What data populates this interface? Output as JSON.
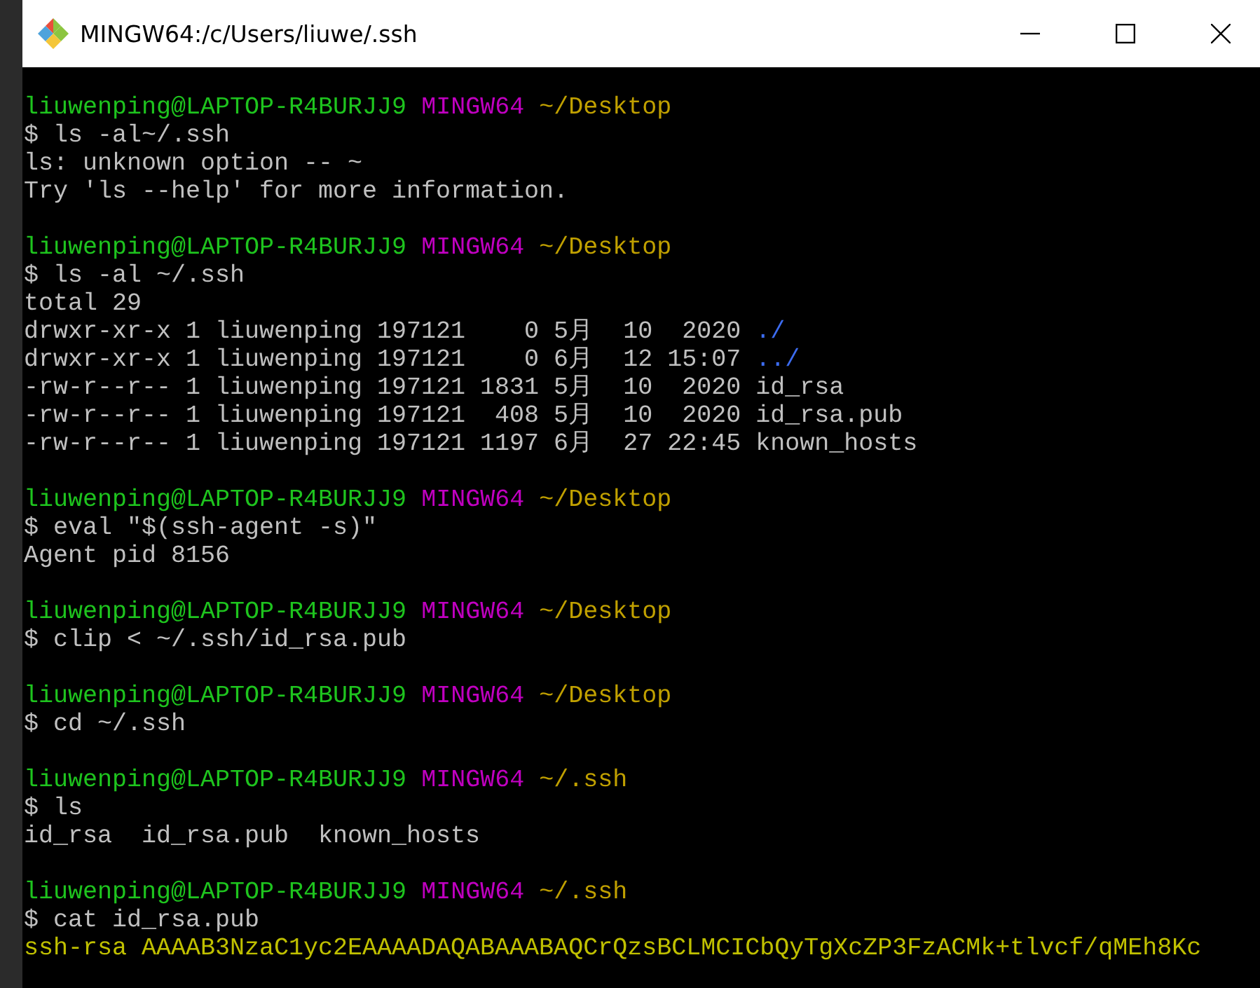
{
  "window": {
    "title": "MINGW64:/c/Users/liuwe/.ssh"
  },
  "lines": [
    {
      "kind": "prompt",
      "user": "liuwenping@LAPTOP-R4BURJJ9",
      "shell": "MINGW64",
      "path": "~/Desktop"
    },
    {
      "kind": "output",
      "segments": [
        {
          "text": "$ ls -al~/.ssh",
          "kind": "plain"
        }
      ]
    },
    {
      "kind": "output",
      "segments": [
        {
          "text": "ls: unknown option -- ~",
          "kind": "plain"
        }
      ]
    },
    {
      "kind": "output",
      "segments": [
        {
          "text": "Try 'ls --help' for more information.",
          "kind": "plain"
        }
      ]
    },
    {
      "kind": "blank"
    },
    {
      "kind": "prompt",
      "user": "liuwenping@LAPTOP-R4BURJJ9",
      "shell": "MINGW64",
      "path": "~/Desktop"
    },
    {
      "kind": "output",
      "segments": [
        {
          "text": "$ ls -al ~/.ssh",
          "kind": "plain"
        }
      ]
    },
    {
      "kind": "output",
      "segments": [
        {
          "text": "total 29",
          "kind": "plain"
        }
      ]
    },
    {
      "kind": "output",
      "segments": [
        {
          "text": "drwxr-xr-x 1 liuwenping 197121    0 5月  10  2020",
          "kind": "plain"
        },
        {
          "text": "./",
          "kind": "directory"
        }
      ]
    },
    {
      "kind": "output",
      "segments": [
        {
          "text": "drwxr-xr-x 1 liuwenping 197121    0 6月  12 15:07",
          "kind": "plain"
        },
        {
          "text": "../",
          "kind": "directory"
        }
      ]
    },
    {
      "kind": "output",
      "segments": [
        {
          "text": "-rw-r--r-- 1 liuwenping 197121 1831 5月  10  2020 id_rsa",
          "kind": "plain"
        }
      ]
    },
    {
      "kind": "output",
      "segments": [
        {
          "text": "-rw-r--r-- 1 liuwenping 197121  408 5月  10  2020 id_rsa.pub",
          "kind": "plain"
        }
      ]
    },
    {
      "kind": "output",
      "segments": [
        {
          "text": "-rw-r--r-- 1 liuwenping 197121 1197 6月  27 22:45 known_hosts",
          "kind": "plain"
        }
      ]
    },
    {
      "kind": "blank"
    },
    {
      "kind": "prompt",
      "user": "liuwenping@LAPTOP-R4BURJJ9",
      "shell": "MINGW64",
      "path": "~/Desktop"
    },
    {
      "kind": "output",
      "segments": [
        {
          "text": "$ eval \"$(ssh-agent -s)\"",
          "kind": "plain"
        }
      ]
    },
    {
      "kind": "output",
      "segments": [
        {
          "text": "Agent pid 8156",
          "kind": "plain"
        }
      ]
    },
    {
      "kind": "blank"
    },
    {
      "kind": "prompt",
      "user": "liuwenping@LAPTOP-R4BURJJ9",
      "shell": "MINGW64",
      "path": "~/Desktop"
    },
    {
      "kind": "output",
      "segments": [
        {
          "text": "$ clip < ~/.ssh/id_rsa.pub",
          "kind": "plain"
        }
      ]
    },
    {
      "kind": "blank"
    },
    {
      "kind": "prompt",
      "user": "liuwenping@LAPTOP-R4BURJJ9",
      "shell": "MINGW64",
      "path": "~/Desktop"
    },
    {
      "kind": "output",
      "segments": [
        {
          "text": "$ cd ~/.ssh",
          "kind": "plain"
        }
      ]
    },
    {
      "kind": "blank"
    },
    {
      "kind": "prompt",
      "user": "liuwenping@LAPTOP-R4BURJJ9",
      "shell": "MINGW64",
      "path": "~/.ssh"
    },
    {
      "kind": "output",
      "segments": [
        {
          "text": "$ ls",
          "kind": "plain"
        }
      ]
    },
    {
      "kind": "output",
      "segments": [
        {
          "text": "id_rsa  id_rsa.pub  known_hosts",
          "kind": "plain"
        }
      ]
    },
    {
      "kind": "blank"
    },
    {
      "kind": "prompt",
      "user": "liuwenping@LAPTOP-R4BURJJ9",
      "shell": "MINGW64",
      "path": "~/.ssh"
    },
    {
      "kind": "output",
      "segments": [
        {
          "text": "$ cat id_rsa.pub",
          "kind": "plain"
        }
      ]
    },
    {
      "kind": "output",
      "segments": [
        {
          "text": "ssh-rsa AAAAB3NzaC1yc2EAAAADAQABAAABAQCrQzsBCLMCICbQyTgXcZP3FzACMk+tlvcf/qMEh8Kc",
          "kind": "key"
        }
      ]
    }
  ]
}
